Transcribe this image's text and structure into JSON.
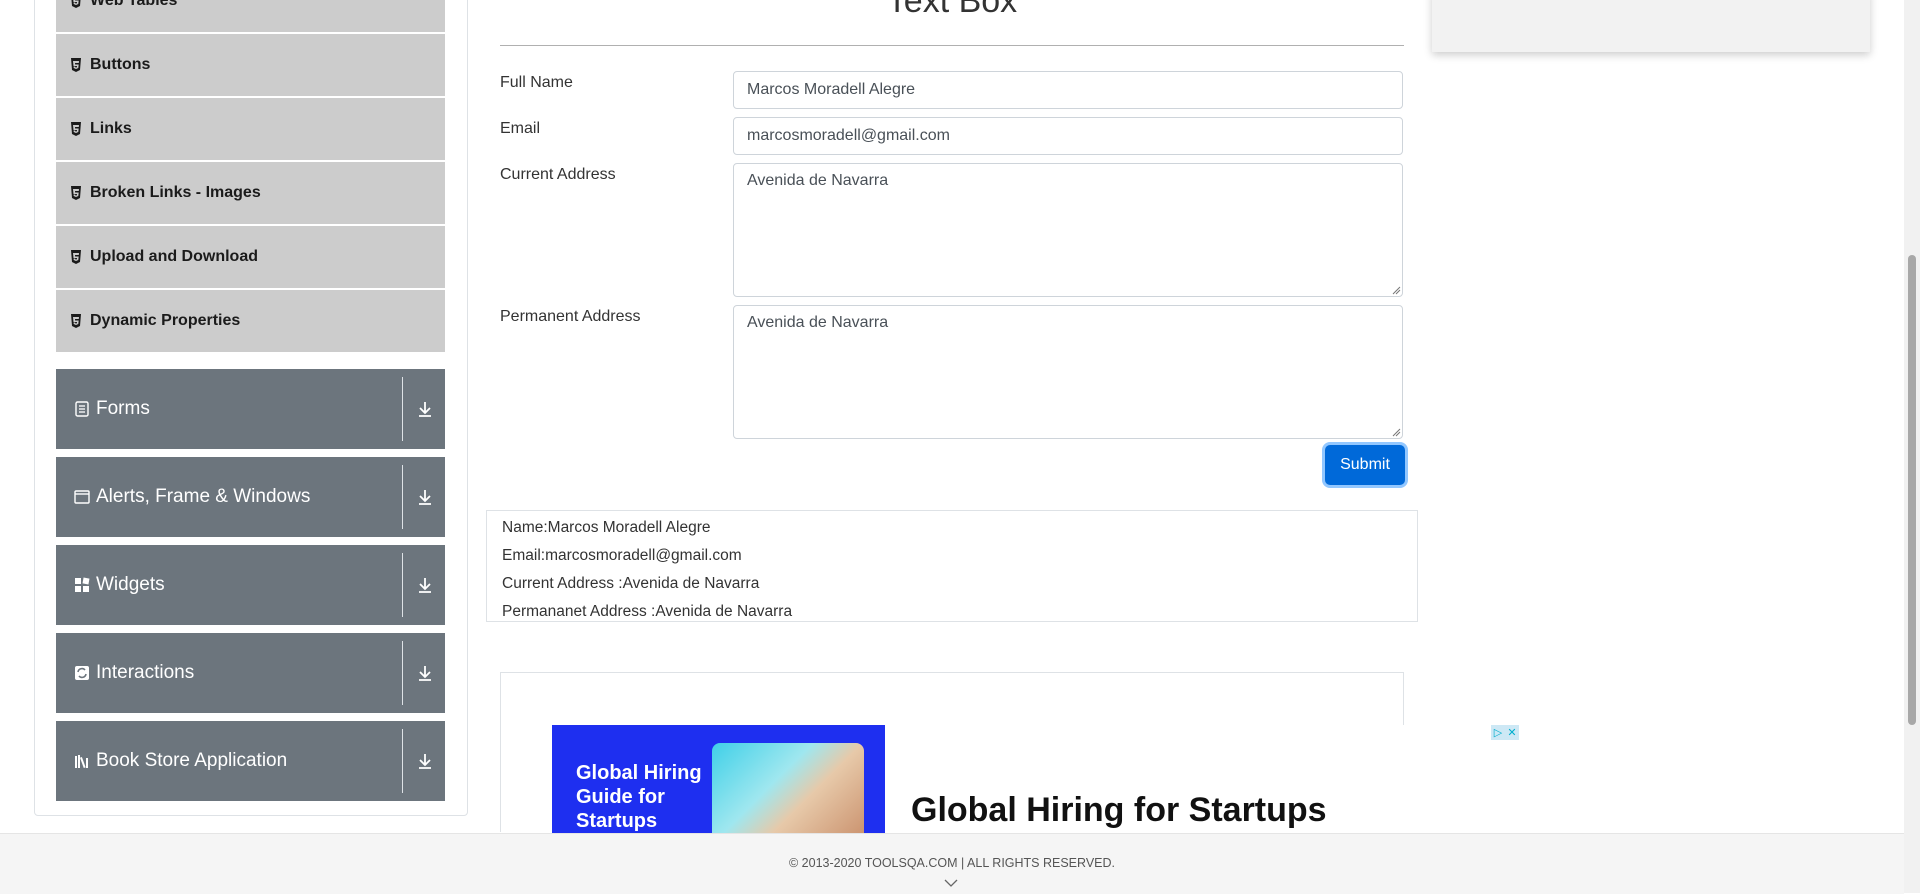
{
  "sidebar": {
    "elements_items": [
      {
        "label": "Web Tables"
      },
      {
        "label": "Buttons"
      },
      {
        "label": "Links"
      },
      {
        "label": "Broken Links - Images"
      },
      {
        "label": "Upload and Download"
      },
      {
        "label": "Dynamic Properties"
      }
    ],
    "groups": [
      {
        "label": "Forms",
        "icon": "form-icon"
      },
      {
        "label": "Alerts, Frame & Windows",
        "icon": "window-icon"
      },
      {
        "label": "Widgets",
        "icon": "widgets-icon"
      },
      {
        "label": "Interactions",
        "icon": "interactions-icon"
      },
      {
        "label": "Book Store Application",
        "icon": "books-icon"
      }
    ]
  },
  "main": {
    "title": "Text Box",
    "form": {
      "full_name_label": "Full Name",
      "full_name_value": "Marcos Moradell Alegre",
      "email_label": "Email",
      "email_value": "marcosmoradell@gmail.com",
      "current_address_label": "Current Address",
      "current_address_value": "Avenida de Navarra",
      "permanent_address_label": "Permanent Address",
      "permanent_address_value": "Avenida de Navarra",
      "submit_label": "Submit"
    },
    "output": {
      "name": "Name:Marcos Moradell Alegre",
      "email": "Email:marcosmoradell@gmail.com",
      "current_address": "Current Address :Avenida de Navarra",
      "permanent_address": "Permananet Address :Avenida de Navarra"
    }
  },
  "ad": {
    "left_text": "Global Hiring Guide for Startups",
    "headline": "Global Hiring for Startups"
  },
  "footer": {
    "copyright": "© 2013-2020 TOOLSQA.COM | ALL RIGHTS RESERVED."
  },
  "colors": {
    "sidebar_group_bg": "#6c757d",
    "sidebar_item_bg": "#cccccc",
    "submit_bg": "#0069d9",
    "ad_blue": "#1e2ff0"
  }
}
